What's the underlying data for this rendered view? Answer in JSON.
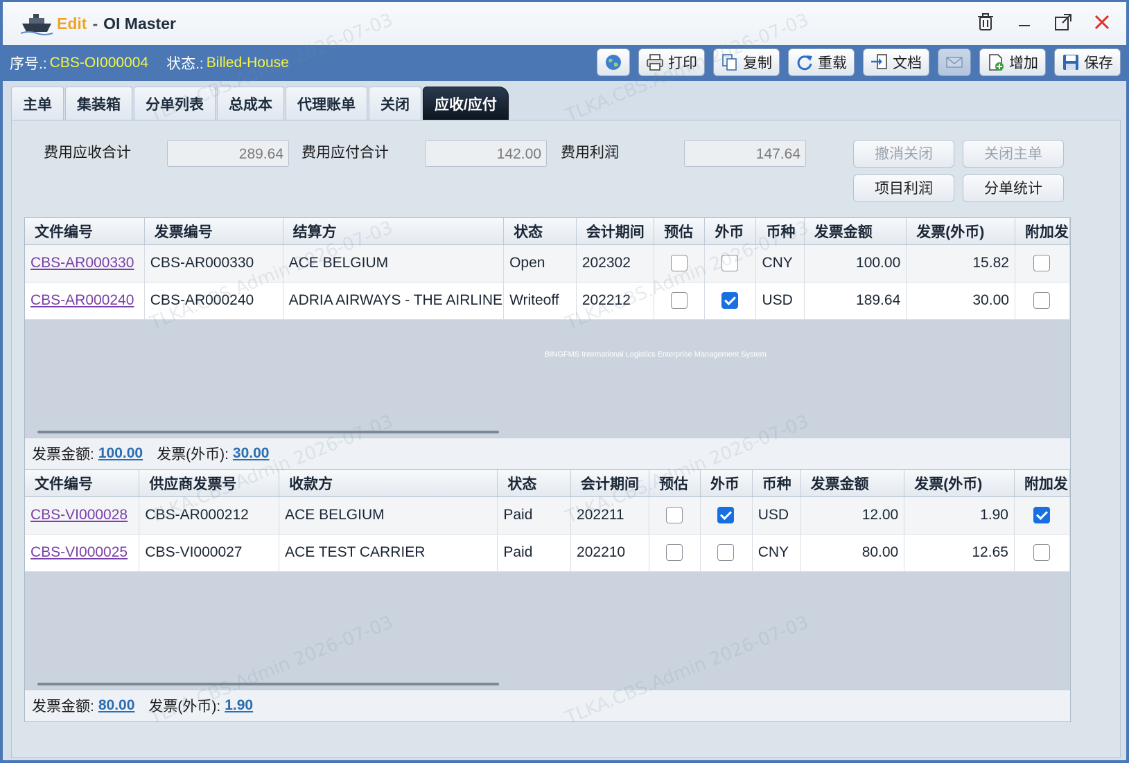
{
  "window": {
    "title_edit": "Edit",
    "title_sep": "-",
    "title_name": "OI Master"
  },
  "info": {
    "seq_label": "序号.:",
    "seq_value": "CBS-OI000004",
    "status_label": "状态.:",
    "status_value": "Billed-House"
  },
  "toolbar": {
    "print": "打印",
    "copy": "复制",
    "reload": "重载",
    "doc": "文档",
    "add": "增加",
    "save": "保存"
  },
  "tabs": [
    "主单",
    "集装箱",
    "分单列表",
    "总成本",
    "代理账单",
    "关闭",
    "应收/应付"
  ],
  "summary": {
    "receivable_label": "费用应收合计",
    "receivable_value": "289.64",
    "payable_label": "费用应付合计",
    "payable_value": "142.00",
    "profit_label": "费用利润",
    "profit_value": "147.64",
    "btn_cancel_close": "撤消关闭",
    "btn_close_master": "关闭主单",
    "btn_project_profit": "项目利润",
    "btn_house_stats": "分单统计"
  },
  "ar_grid": {
    "headers": [
      "文件编号",
      "发票编号",
      "结算方",
      "状态",
      "会计期间",
      "预估",
      "外币",
      "币种",
      "发票金额",
      "发票(外币)",
      "附加发"
    ],
    "rows": [
      {
        "file_no": "CBS-AR000330",
        "invoice_no": "CBS-AR000330",
        "party": "ACE BELGIUM",
        "status": "Open",
        "period": "202302",
        "estimate": false,
        "foreign": false,
        "currency": "CNY",
        "amount": "100.00",
        "amount_fc": "15.82",
        "extra": false
      },
      {
        "file_no": "CBS-AR000240",
        "invoice_no": "CBS-AR000240",
        "party": "ADRIA AIRWAYS - THE AIRLINE",
        "status": "Writeoff",
        "period": "202212",
        "estimate": false,
        "foreign": true,
        "currency": "USD",
        "amount": "189.64",
        "amount_fc": "30.00",
        "extra": false
      }
    ],
    "note": "BINGFMS International Logistics Enterprise Management System",
    "footer_amount_label": "发票金额:",
    "footer_amount_value": "100.00",
    "footer_fc_label": "发票(外币):",
    "footer_fc_value": "30.00"
  },
  "ap_grid": {
    "headers": [
      "文件编号",
      "供应商发票号",
      "收款方",
      "状态",
      "会计期间",
      "预估",
      "外币",
      "币种",
      "发票金额",
      "发票(外币)",
      "附加发"
    ],
    "rows": [
      {
        "file_no": "CBS-VI000028",
        "invoice_no": "CBS-AR000212",
        "party": "ACE BELGIUM",
        "status": "Paid",
        "period": "202211",
        "estimate": false,
        "foreign": true,
        "currency": "USD",
        "amount": "12.00",
        "amount_fc": "1.90",
        "extra": true
      },
      {
        "file_no": "CBS-VI000025",
        "invoice_no": "CBS-VI000027",
        "party": "ACE TEST CARRIER",
        "status": "Paid",
        "period": "202210",
        "estimate": false,
        "foreign": false,
        "currency": "CNY",
        "amount": "80.00",
        "amount_fc": "12.65",
        "extra": false
      }
    ],
    "footer_amount_label": "发票金额:",
    "footer_amount_value": "80.00",
    "footer_fc_label": "发票(外币):",
    "footer_fc_value": "1.90"
  },
  "watermark": "TLKA.CBS.Admin 2026-07-03"
}
